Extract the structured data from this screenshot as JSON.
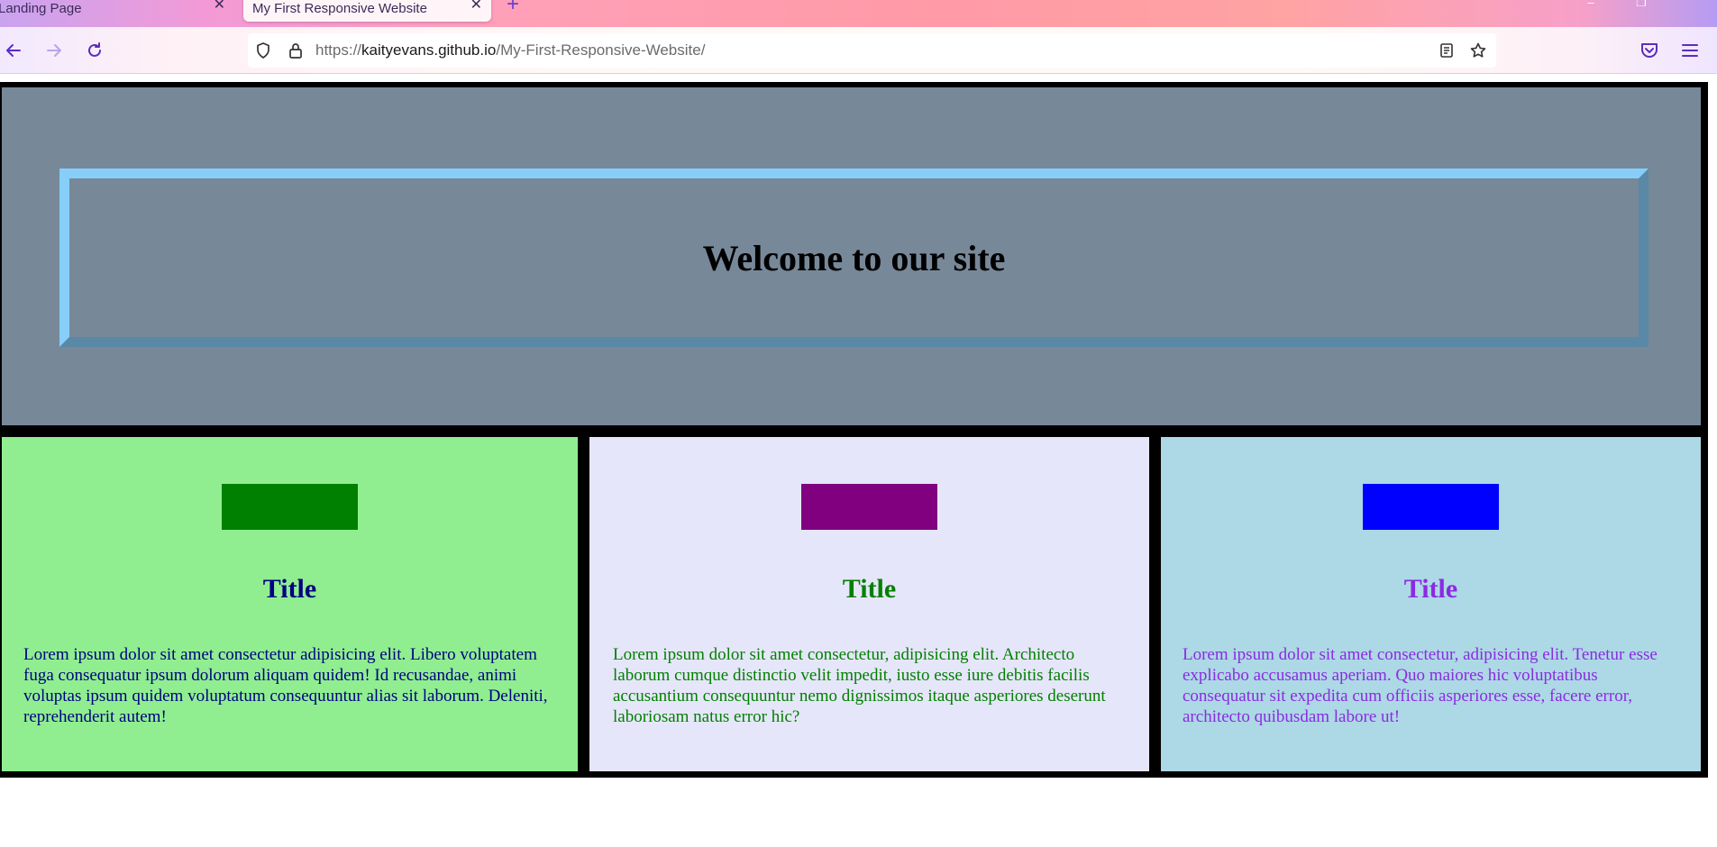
{
  "browser": {
    "tabs": [
      {
        "title": "Landing Page",
        "active": false
      },
      {
        "title": "My First Responsive Website",
        "active": true
      }
    ],
    "url": {
      "scheme": "https://",
      "host": "kaityevans.github.io",
      "path": "/My-First-Responsive-Website/"
    }
  },
  "hero": {
    "title": "Welcome to our site"
  },
  "cards": [
    {
      "title": "Title",
      "text": "Lorem ipsum dolor sit amet consectetur adipisicing elit. Libero voluptatem fuga consequatur ipsum dolorum aliquam quidem! Id recusandae, animi voluptas ipsum quidem voluptatum consequuntur alias sit laborum. Deleniti, reprehenderit autem!",
      "background": "#90ee90",
      "swatch_color": "#008000",
      "text_color": "#000080"
    },
    {
      "title": "Title",
      "text": "Lorem ipsum dolor sit amet consectetur, adipisicing elit. Architecto laborum cumque distinctio velit impedit, iusto esse iure debitis facilis accusantium consequuntur nemo dignissimos itaque asperiores deserunt laboriosam natus error hic?",
      "background": "#e6e6fa",
      "swatch_color": "#800080",
      "text_color": "#008000"
    },
    {
      "title": "Title",
      "text": "Lorem ipsum dolor sit amet consectetur, adipisicing elit. Tenetur esse explicabo accusamus aperiam. Quo maiores hic voluptatibus consequatur sit expedita cum officiis asperiores esse, facere error, architecto quibusdam labore ut!",
      "background": "#add8e6",
      "swatch_color": "#0000ff",
      "text_color": "#8a2be2"
    }
  ],
  "colors": {
    "hero_background": "#778899",
    "hero_border": "#87cefa",
    "page_border": "#000000"
  }
}
